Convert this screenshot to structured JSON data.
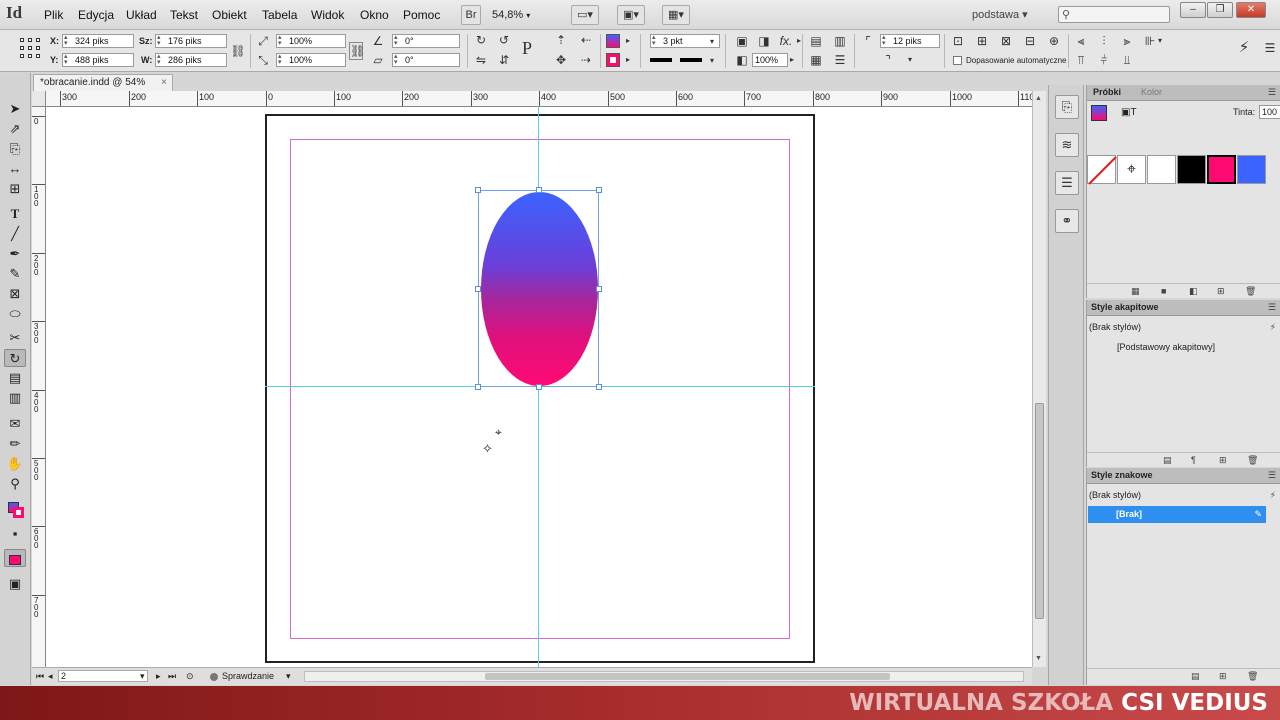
{
  "app": {
    "logo": "Id",
    "menu": [
      "Plik",
      "Edycja",
      "Układ",
      "Tekst",
      "Obiekt",
      "Tabela",
      "Widok",
      "Okno",
      "Pomoc"
    ],
    "bridge_label": "Br",
    "zoom": "54,8%",
    "workspace": "podstawa",
    "window_buttons": [
      "–",
      "❐",
      "✕"
    ]
  },
  "control_bar": {
    "x_label": "X:",
    "x_value": "324 piks",
    "y_label": "Y:",
    "y_value": "488 piks",
    "w_label": "Sz:",
    "w_value": "176 piks",
    "h_label": "W:",
    "h_value": "286 piks",
    "scale_x": "100%",
    "scale_y": "100%",
    "rotate": "0°",
    "shear": "0°",
    "stroke_weight": "3 pkt",
    "opacity": "100%",
    "spacing": "12 piks",
    "auto_fit": "Dopasowanie automatyczne"
  },
  "document": {
    "tab_title": "*obracanie.indd @ 54%",
    "ruler_h_labels": [
      "300",
      "200",
      "100",
      "0",
      "100",
      "200",
      "300",
      "400",
      "500",
      "600",
      "700",
      "800",
      "900",
      "1000",
      "110"
    ],
    "ruler_v_labels": [
      "0",
      "1 0 0",
      "2 0 0",
      "3 0 0",
      "4 0 0",
      "5 0 0",
      "6 0 0",
      "7 0 0"
    ]
  },
  "status_bar": {
    "page": "2",
    "preflight": "Sprawdzanie"
  },
  "swatches_panel": {
    "tab_active": "Próbki",
    "tab_inactive": "Kolor",
    "tint_label": "Tinta:",
    "tint_value": "100",
    "tint_unit": "%",
    "colors": {
      "none": "#ffffff",
      "registration": "#ffffff",
      "paper": "#ffffff",
      "black": "#000000",
      "magenta": "#ff0a73",
      "blue": "#3b63ff"
    }
  },
  "paragraph_styles": {
    "title": "Style akapitowe",
    "row1": "(Brak stylów)",
    "row2": "[Podstawowy akapitowy]"
  },
  "character_styles": {
    "title": "Style znakowe",
    "row1": "(Brak stylów)",
    "selected": "[Brak]"
  },
  "watermark": {
    "part1": "WIRTUALNA SZKOŁA",
    "part2": "CSI VEDIUS"
  },
  "object_gradient": {
    "top": "#3b63ff",
    "bottom": "#ff0a73"
  }
}
